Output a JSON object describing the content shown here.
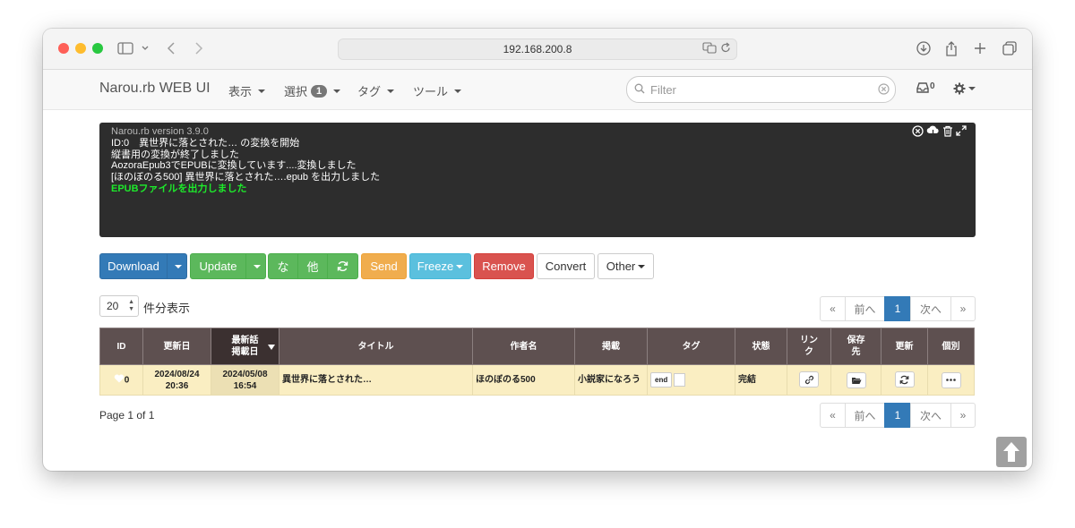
{
  "browser": {
    "address": "192.168.200.8"
  },
  "navbar": {
    "brand": "Narou.rb WEB UI",
    "menu_view": "表示",
    "menu_select": "選択",
    "select_count": "1",
    "menu_tag": "タグ",
    "menu_tools": "ツール",
    "filter_placeholder": "Filter",
    "notification_count": "0"
  },
  "console": {
    "lines": [
      "Narou.rb version 3.9.0",
      "ID:0　異世界に落とされた… の変換を開始",
      "縦書用の変換が終了しました",
      "AozoraEpub3でEPUBに変換しています....変換しました",
      "[ほのぼのる500] 異世界に落とされた….epub を出力しました",
      "EPUBファイルを出力しました"
    ]
  },
  "toolbar": {
    "download": "Download",
    "update": "Update",
    "na": "な",
    "other_kanji": "他",
    "send": "Send",
    "freeze": "Freeze",
    "remove": "Remove",
    "convert": "Convert",
    "other": "Other"
  },
  "per_page": {
    "value": "20",
    "label": "件分表示"
  },
  "pagination": {
    "first": "«",
    "prev": "前へ",
    "current": "1",
    "next": "次へ",
    "last": "»"
  },
  "table": {
    "headers": {
      "id": "ID",
      "updated": "更新日",
      "latest_line1": "最新話",
      "latest_line2": "掲載日",
      "title": "タイトル",
      "author": "作者名",
      "site": "掲載",
      "tag": "タグ",
      "status": "状態",
      "link_line1": "リン",
      "link_line2": "ク",
      "save_line1": "保存",
      "save_line2": "先",
      "update": "更新",
      "each": "個別"
    },
    "rows": [
      {
        "id": "0",
        "updated_date": "2024/08/24",
        "updated_time": "20:36",
        "latest_date": "2024/05/08",
        "latest_time": "16:54",
        "title": "異世界に落とされた…",
        "author": "ほのぼのる500",
        "site": "小説家になろう",
        "tag": "end",
        "status": "完結"
      }
    ]
  },
  "page_info": "Page 1 of 1"
}
